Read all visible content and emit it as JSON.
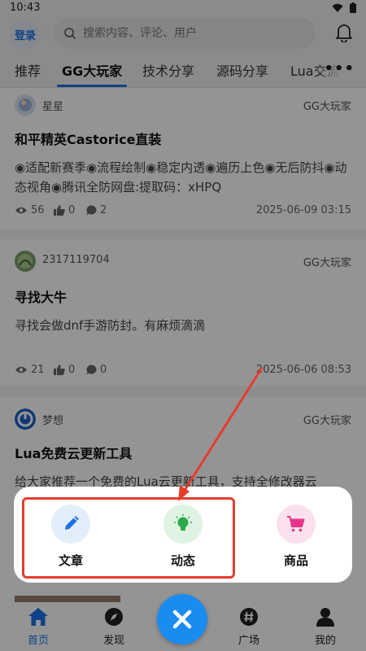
{
  "status": {
    "time": "10:43"
  },
  "header": {
    "login_label": "登录",
    "search_placeholder": "搜索内容、评论、用户"
  },
  "tabs": [
    {
      "label": "推荐"
    },
    {
      "label": "GG大玩家",
      "active": true
    },
    {
      "label": "技术分享"
    },
    {
      "label": "源码分享"
    },
    {
      "label": "Lua交流"
    }
  ],
  "posts": [
    {
      "author": "星星",
      "category": "GG大玩家",
      "title": "和平精英Castorice直装",
      "body": "◉适配新赛季◉流程绘制◉稳定内透◉遍历上色◉无后防抖◉动态视角◉腾讯全防网盘:提取码：xHPQ",
      "views": "56",
      "likes": "0",
      "comments": "2",
      "date": "2025-06-09 03:15"
    },
    {
      "author": "2317119704",
      "category": "GG大玩家",
      "title": "寻找大牛",
      "body": "寻找会做dnf手游防封。有麻烦滴滴",
      "views": "21",
      "likes": "0",
      "comments": "0",
      "date": "2025-06-06 08:53"
    },
    {
      "author": "梦想",
      "category": "GG大玩家",
      "title": "Lua免费云更新工具",
      "body": "给大家推荐一个免费的Lua云更新工具，支持全修改器云"
    }
  ],
  "popup": {
    "actions": [
      {
        "label": "文章",
        "icon": "pencil-icon",
        "color": "#1a73e8",
        "bg": "#e3eefb"
      },
      {
        "label": "动态",
        "icon": "bulb-icon",
        "color": "#2eaa4a",
        "bg": "#dff3e3"
      },
      {
        "label": "商品",
        "icon": "cart-icon",
        "color": "#e8358c",
        "bg": "#fbe1ee"
      }
    ]
  },
  "nav": {
    "items": [
      {
        "label": "首页",
        "icon": "home-icon",
        "active": true
      },
      {
        "label": "发现",
        "icon": "compass-icon"
      },
      {
        "label": "广场",
        "icon": "hashtag-icon"
      },
      {
        "label": "我的",
        "icon": "user-icon"
      }
    ]
  },
  "colors": {
    "accent": "#1a73e8",
    "annotation": "#e53d2e",
    "fab": "#1a8cf0"
  }
}
